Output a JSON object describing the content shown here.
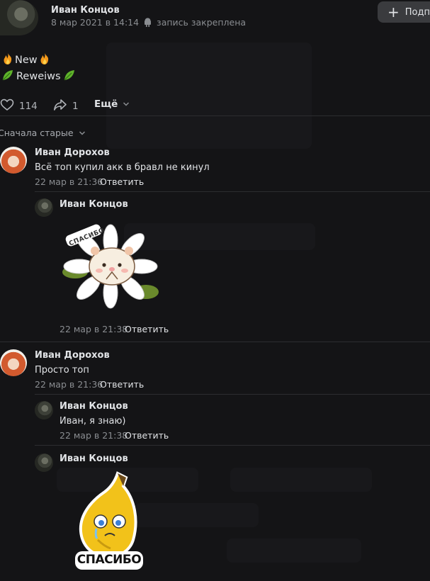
{
  "post": {
    "author": "Иван Концов",
    "date": "8 мар 2021 в 14:14",
    "pinned_label": "запись закреплена",
    "subscribe_label": "Подпи",
    "line1": "New",
    "line2": "Reweiws",
    "likes": "114",
    "shares": "1",
    "more_label": "Ещё"
  },
  "comments_sort": "Сначала старые",
  "reply_label": "Ответить",
  "comments": [
    {
      "author": "Иван Дорохов",
      "text": "Всё топ купил акк в бравл не кинул",
      "date": "22 мар в 21:36"
    },
    {
      "author": "Иван Концов",
      "sticker": "СПАСИБО",
      "date": "22 мар в 21:38"
    },
    {
      "author": "Иван Дорохов",
      "text": "Просто топ",
      "date": "22 мар в 21:36"
    },
    {
      "author": "Иван Концов",
      "text": "Иван, я знаю)",
      "date": "22 мар в 21:38"
    },
    {
      "author": "Иван Концов",
      "sticker": "СПАСИБО"
    }
  ],
  "colors": {
    "background": "#141416",
    "text": "#e1e3e6",
    "muted": "#8a8d91",
    "fire": "#f59a1b",
    "leaf": "#5fb32b"
  }
}
